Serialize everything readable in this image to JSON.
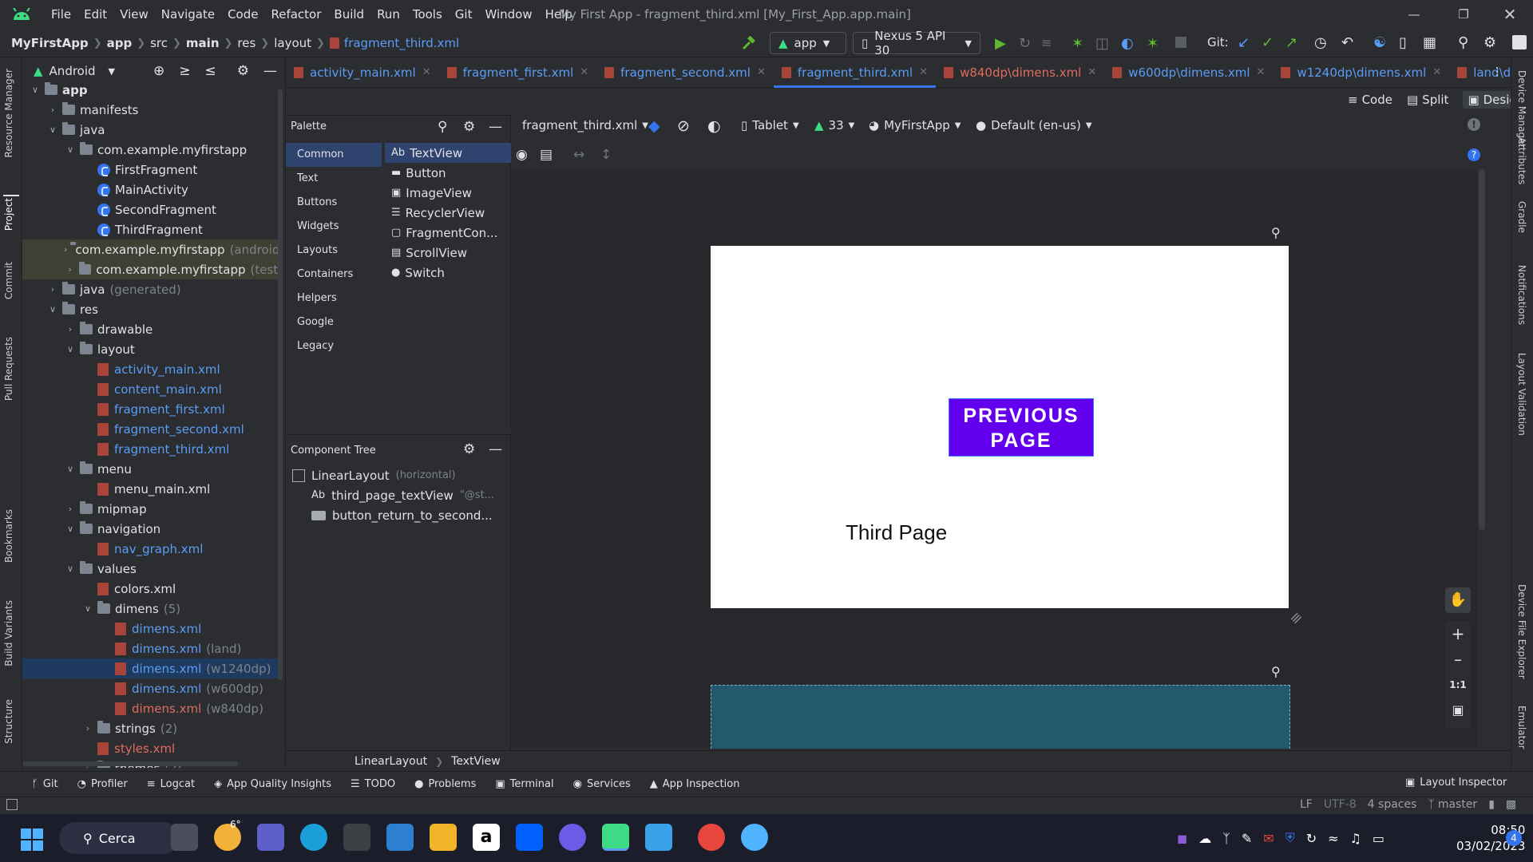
{
  "menu": [
    "File",
    "Edit",
    "View",
    "Navigate",
    "Code",
    "Refactor",
    "Build",
    "Run",
    "Tools",
    "Git",
    "Window",
    "Help"
  ],
  "window_title": "My First App - fragment_third.xml [My_First_App.app.main]",
  "breadcrumbs": [
    "MyFirstApp",
    "app",
    "src",
    "main",
    "res",
    "layout",
    "fragment_third.xml"
  ],
  "run_config": "app",
  "device": "Nexus 5 API 30",
  "git_label": "Git:",
  "project_view": "Android",
  "tree": [
    {
      "label": "app",
      "depth": 0,
      "arrow": "v",
      "type": "module",
      "bold": true
    },
    {
      "label": "manifests",
      "depth": 1,
      "arrow": ">",
      "type": "folder"
    },
    {
      "label": "java",
      "depth": 1,
      "arrow": "v",
      "type": "folder"
    },
    {
      "label": "com.example.myfirstapp",
      "depth": 2,
      "arrow": "v",
      "type": "folder"
    },
    {
      "label": "FirstFragment",
      "depth": 3,
      "arrow": "",
      "type": "class"
    },
    {
      "label": "MainActivity",
      "depth": 3,
      "arrow": "",
      "type": "class"
    },
    {
      "label": "SecondFragment",
      "depth": 3,
      "arrow": "",
      "type": "class"
    },
    {
      "label": "ThirdFragment",
      "depth": 3,
      "arrow": "",
      "type": "class"
    },
    {
      "label": "com.example.myfirstapp",
      "suffix": "(androidT",
      "depth": 2,
      "arrow": ">",
      "type": "folder",
      "hl": true
    },
    {
      "label": "com.example.myfirstapp",
      "suffix": "(test)",
      "depth": 2,
      "arrow": ">",
      "type": "folder",
      "hl": true
    },
    {
      "label": "java",
      "suffix": "(generated)",
      "depth": 1,
      "arrow": ">",
      "type": "folder"
    },
    {
      "label": "res",
      "depth": 1,
      "arrow": "v",
      "type": "folder"
    },
    {
      "label": "drawable",
      "depth": 2,
      "arrow": ">",
      "type": "folder"
    },
    {
      "label": "layout",
      "depth": 2,
      "arrow": "v",
      "type": "folder"
    },
    {
      "label": "activity_main.xml",
      "depth": 3,
      "arrow": "",
      "type": "xml"
    },
    {
      "label": "content_main.xml",
      "depth": 3,
      "arrow": "",
      "type": "xml"
    },
    {
      "label": "fragment_first.xml",
      "depth": 3,
      "arrow": "",
      "type": "xml"
    },
    {
      "label": "fragment_second.xml",
      "depth": 3,
      "arrow": "",
      "type": "xml"
    },
    {
      "label": "fragment_third.xml",
      "depth": 3,
      "arrow": "",
      "type": "xml"
    },
    {
      "label": "menu",
      "depth": 2,
      "arrow": "v",
      "type": "folder"
    },
    {
      "label": "menu_main.xml",
      "depth": 3,
      "arrow": "",
      "type": "xml-plain"
    },
    {
      "label": "mipmap",
      "depth": 2,
      "arrow": ">",
      "type": "folder"
    },
    {
      "label": "navigation",
      "depth": 2,
      "arrow": "v",
      "type": "folder"
    },
    {
      "label": "nav_graph.xml",
      "depth": 3,
      "arrow": "",
      "type": "xml"
    },
    {
      "label": "values",
      "depth": 2,
      "arrow": "v",
      "type": "folder"
    },
    {
      "label": "colors.xml",
      "depth": 3,
      "arrow": "",
      "type": "xml-plain"
    },
    {
      "label": "dimens",
      "suffix": "(5)",
      "depth": 3,
      "arrow": "v",
      "type": "folder"
    },
    {
      "label": "dimens.xml",
      "depth": 4,
      "arrow": "",
      "type": "xml"
    },
    {
      "label": "dimens.xml",
      "suffix": "(land)",
      "depth": 4,
      "arrow": "",
      "type": "xml"
    },
    {
      "label": "dimens.xml",
      "suffix": "(w1240dp)",
      "depth": 4,
      "arrow": "",
      "type": "xml",
      "sel": true
    },
    {
      "label": "dimens.xml",
      "suffix": "(w600dp)",
      "depth": 4,
      "arrow": "",
      "type": "xml"
    },
    {
      "label": "dimens.xml",
      "suffix": "(w840dp)",
      "depth": 4,
      "arrow": "",
      "type": "xml-red"
    },
    {
      "label": "strings",
      "suffix": "(2)",
      "depth": 3,
      "arrow": ">",
      "type": "folder"
    },
    {
      "label": "styles.xml",
      "depth": 3,
      "arrow": "",
      "type": "xml-red"
    },
    {
      "label": "themes",
      "suffix": "(2)",
      "depth": 3,
      "arrow": ">",
      "type": "folder"
    }
  ],
  "tabs": [
    {
      "label": "activity_main.xml",
      "state": "normal"
    },
    {
      "label": "fragment_first.xml",
      "state": "normal"
    },
    {
      "label": "fragment_second.xml",
      "state": "normal"
    },
    {
      "label": "fragment_third.xml",
      "state": "active"
    },
    {
      "label": "w840dp\\dimens.xml",
      "state": "err"
    },
    {
      "label": "w600dp\\dimens.xml",
      "state": "normal"
    },
    {
      "label": "w1240dp\\dimens.xml",
      "state": "normal"
    },
    {
      "label": "land\\dimen:",
      "state": "normal"
    }
  ],
  "modes": {
    "code": "Code",
    "split": "Split",
    "design": "Design"
  },
  "palette": {
    "title": "Palette",
    "categories": [
      "Common",
      "Text",
      "Buttons",
      "Widgets",
      "Layouts",
      "Containers",
      "Helpers",
      "Google",
      "Legacy"
    ],
    "items": [
      "TextView",
      "Button",
      "ImageView",
      "RecyclerView",
      "FragmentCon...",
      "ScrollView",
      "Switch"
    ]
  },
  "design_toolbar": {
    "file": "fragment_third.xml",
    "device": "Tablet",
    "api": "33",
    "theme": "MyFirstApp",
    "locale": "Default (en-us)"
  },
  "component_tree": {
    "title": "Component Tree",
    "nodes": [
      {
        "label": "LinearLayout",
        "hint": "(horizontal)"
      },
      {
        "label": "third_page_textView",
        "hint": "\"@st..."
      },
      {
        "label": "button_return_to_second...",
        "hint": ""
      }
    ]
  },
  "preview": {
    "button_line1": "PREVIOUS",
    "button_line2": "PAGE",
    "text": "Third Page"
  },
  "bottom_crumbs": [
    "LinearLayout",
    "TextView"
  ],
  "zoom": {
    "fit": "1:1"
  },
  "toolwindows": [
    "Git",
    "Profiler",
    "Logcat",
    "App Quality Insights",
    "TODO",
    "Problems",
    "Terminal",
    "Services",
    "App Inspection"
  ],
  "layout_inspector": "Layout Inspector",
  "status": {
    "lf": "LF",
    "enc": "UTF-8",
    "indent": "4 spaces",
    "branch": "master"
  },
  "left_strip": [
    "Resource Manager",
    "Project",
    "Commit",
    "Pull Requests",
    "Bookmarks",
    "Build Variants",
    "Structure"
  ],
  "right_strip": [
    "Device Manager",
    "Attributes",
    "Gradle",
    "Notifications",
    "Layout Validation",
    "Device File Explorer",
    "Emulator"
  ],
  "taskbar": {
    "search": "Cerca",
    "time": "08:50",
    "date": "03/02/2023",
    "weather": "6°",
    "notif": "4"
  },
  "colors": {
    "accent": "#3574f0",
    "button": "#6200ee",
    "selection": "#1f3a5f"
  }
}
